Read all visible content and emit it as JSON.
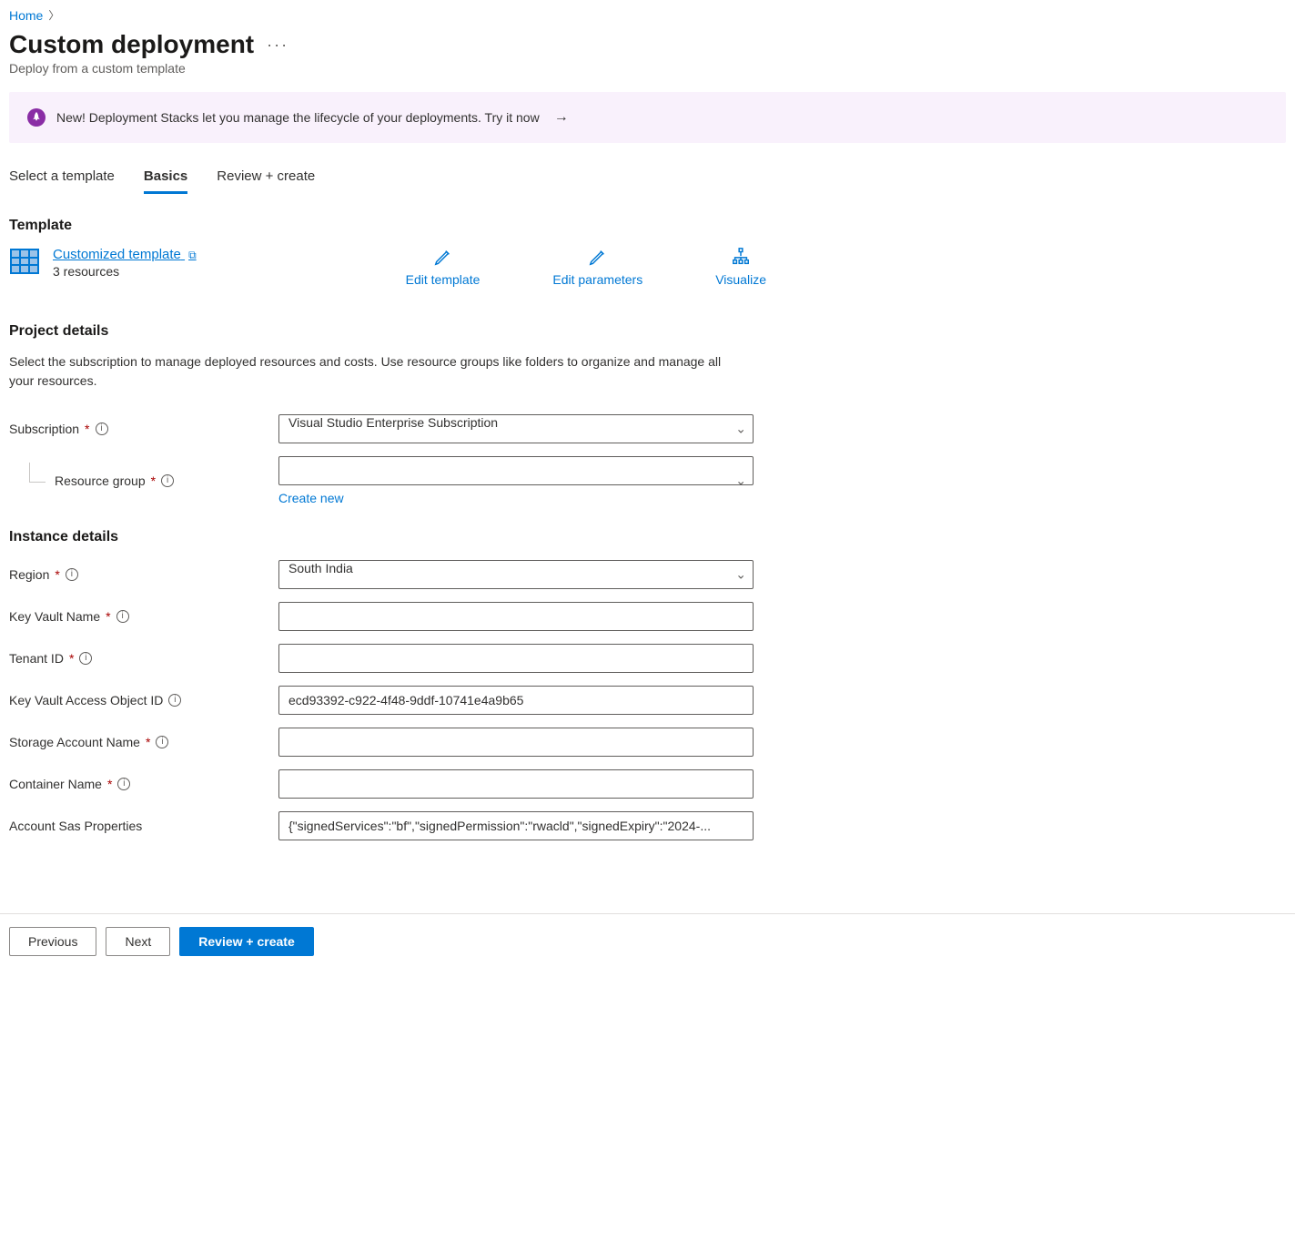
{
  "breadcrumb": {
    "home": "Home"
  },
  "header": {
    "title": "Custom deployment",
    "subtitle": "Deploy from a custom template"
  },
  "banner": {
    "text": "New! Deployment Stacks let you manage the lifecycle of your deployments. Try it now"
  },
  "tabs": {
    "select_template": "Select a template",
    "basics": "Basics",
    "review_create": "Review + create"
  },
  "template": {
    "heading": "Template",
    "link_label": "Customized template",
    "resource_count": "3 resources",
    "edit_template": "Edit template",
    "edit_parameters": "Edit parameters",
    "visualize": "Visualize"
  },
  "project": {
    "heading": "Project details",
    "description": "Select the subscription to manage deployed resources and costs. Use resource groups like folders to organize and manage all your resources.",
    "subscription_label": "Subscription",
    "subscription_value": "Visual Studio Enterprise Subscription",
    "resource_group_label": "Resource group",
    "resource_group_value": "",
    "create_new": "Create new"
  },
  "instance": {
    "heading": "Instance details",
    "region_label": "Region",
    "region_value": "South India",
    "key_vault_name_label": "Key Vault Name",
    "key_vault_name_value": "",
    "tenant_id_label": "Tenant ID",
    "tenant_id_value": "",
    "kv_access_object_id_label": "Key Vault Access Object ID",
    "kv_access_object_id_value": "ecd93392-c922-4f48-9ddf-10741e4a9b65",
    "storage_account_name_label": "Storage Account Name",
    "storage_account_name_value": "",
    "container_name_label": "Container Name",
    "container_name_value": "",
    "account_sas_label": "Account Sas Properties",
    "account_sas_value": "{\"signedServices\":\"bf\",\"signedPermission\":\"rwacld\",\"signedExpiry\":\"2024-..."
  },
  "footer": {
    "previous": "Previous",
    "next": "Next",
    "review_create": "Review + create"
  }
}
